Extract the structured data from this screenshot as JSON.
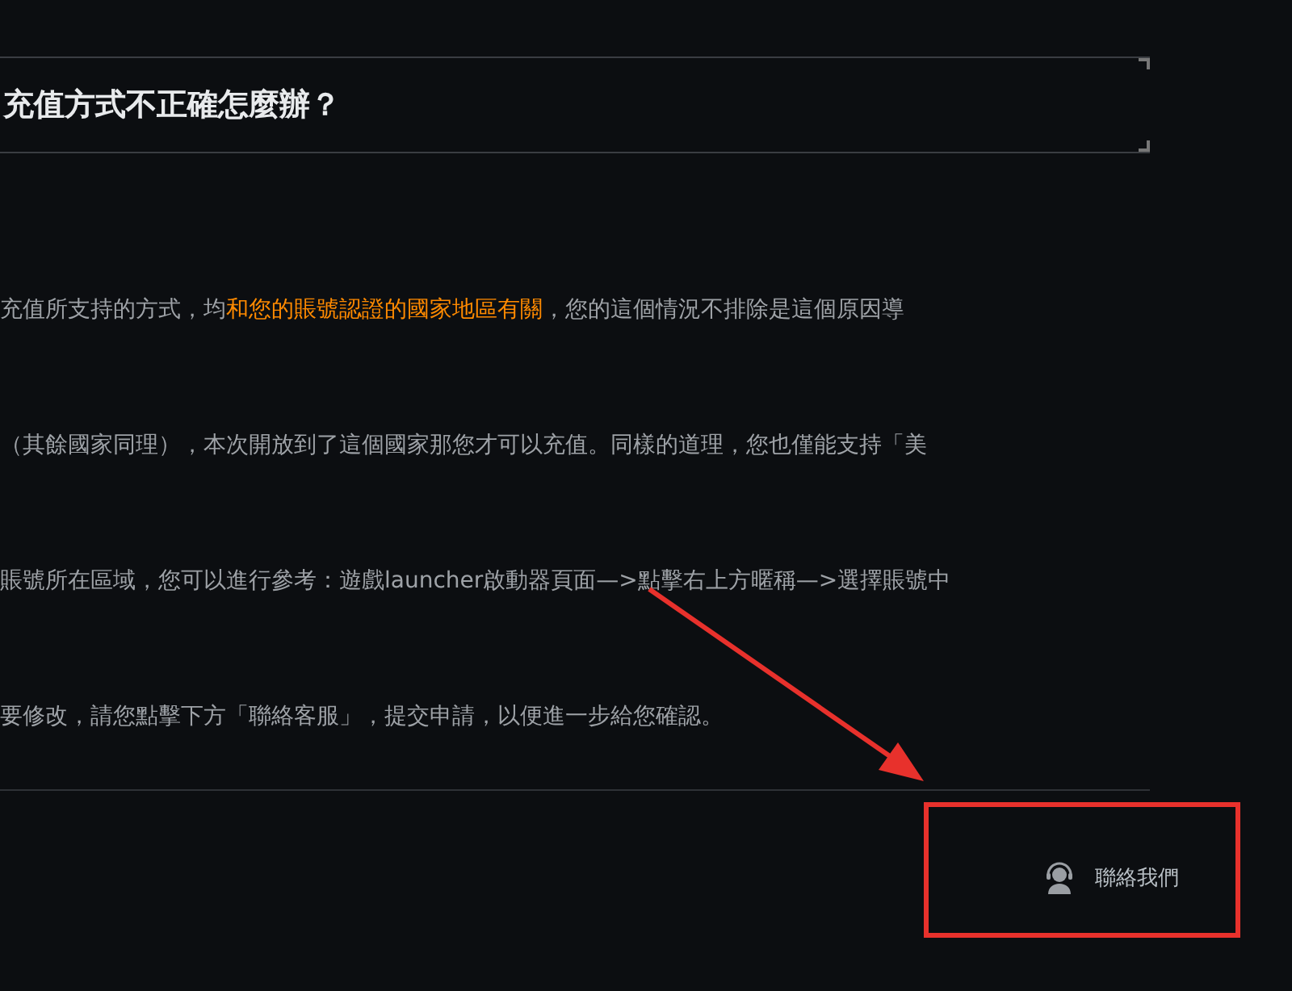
{
  "title": "充值方式不正確怎麼辦？",
  "paragraphs": [
    [
      {
        "text": "充值所支持的方式，均",
        "highlight": false
      },
      {
        "text": "和您的賬號認證的國家地區有關",
        "highlight": true
      },
      {
        "text": "，您的這個情況不排除是這個原因導",
        "highlight": false
      }
    ],
    [
      {
        "text": "（其餘國家同理），本次開放到了這個國家那您才可以充值。同樣的道理，您也僅能支持「美",
        "highlight": false
      }
    ],
    [
      {
        "text": "賬號所在區域，您可以進行參考：遊戲launcher啟動器頁面—>點擊右上方暱稱—>選擇賬號中",
        "highlight": false
      }
    ],
    [
      {
        "text": "要修改，請您點擊下方「聯絡客服」，提交申請，以便進一步給您確認。",
        "highlight": false
      }
    ]
  ],
  "contact": {
    "label": "聯絡我們"
  }
}
